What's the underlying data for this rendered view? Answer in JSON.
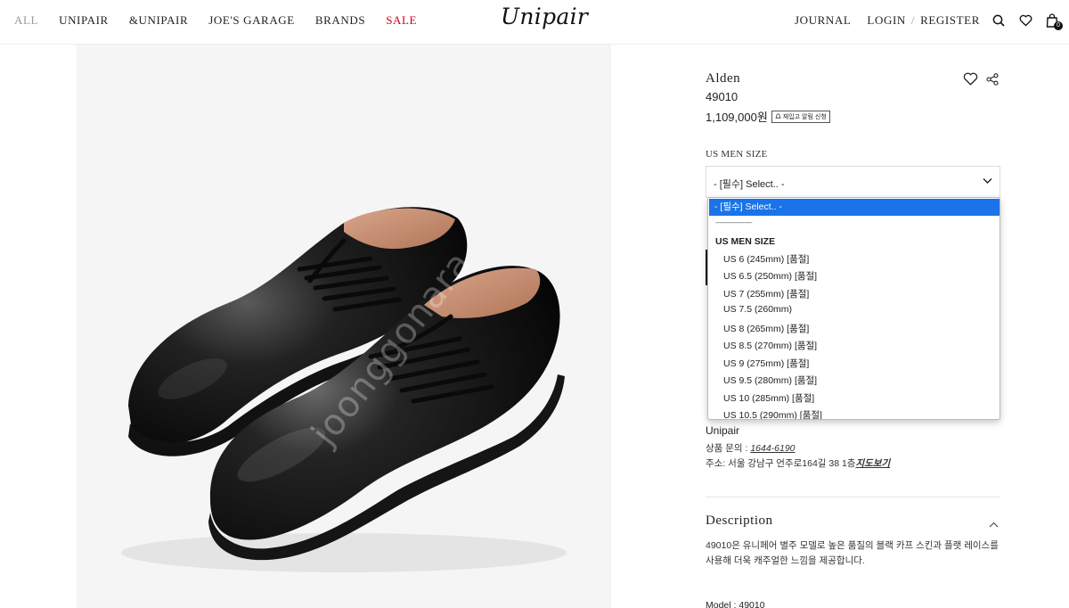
{
  "nav": {
    "left": [
      "ALL",
      "UNIPAIR",
      "&UNIPAIR",
      "JOE'S GARAGE",
      "BRANDS",
      "SALE"
    ],
    "logo": "Unipair",
    "journal": "JOURNAL",
    "login": "LOGIN",
    "separator": "/",
    "register": "REGISTER",
    "cart_count": "0",
    "icons": [
      "search-icon",
      "heart-icon",
      "bag-icon"
    ]
  },
  "image": {
    "watermark": "joonggonara"
  },
  "product": {
    "brand": "Alden",
    "name": "49010",
    "price": "1,109,000원",
    "restock_label": "재입고 알림 신청"
  },
  "size": {
    "label": "US MEN SIZE",
    "select_value": "- [필수] Select.. -"
  },
  "dropdown": {
    "selected": "- [필수] Select.. -",
    "separator": "-------------------",
    "group": "US MEN SIZE",
    "options": [
      "US 6 (245mm) [품절]",
      "US 6.5 (250mm) [품절]",
      "US 7 (255mm) [품절]",
      "US 7.5 (260mm)",
      "US 8 (265mm) [품절]",
      "US 8.5 (270mm) [품절]",
      "US 9 (275mm) [품절]",
      "US 9.5 (280mm) [품절]",
      "US 10 (285mm) [품절]",
      "US 10.5 (290mm) [품절]"
    ]
  },
  "store": {
    "name": "Unipair",
    "phone_label": "상품 문의 : ",
    "phone": "1644-6190",
    "address_label": "주소: 서울 강남구 언주로164길 38 1층",
    "map_link": "지도보기"
  },
  "description": {
    "title": "Description",
    "text": "49010은 유니페어 별주 모델로 높은 품질의 블랙 카프 스킨과 플랫 레이스를 사용해 더욱 캐주얼한 느낌을 제공합니다.",
    "model": "Model : 49010"
  },
  "colors": {
    "sale": "#d0021b",
    "dropdown_highlight": "#1a73e8"
  }
}
